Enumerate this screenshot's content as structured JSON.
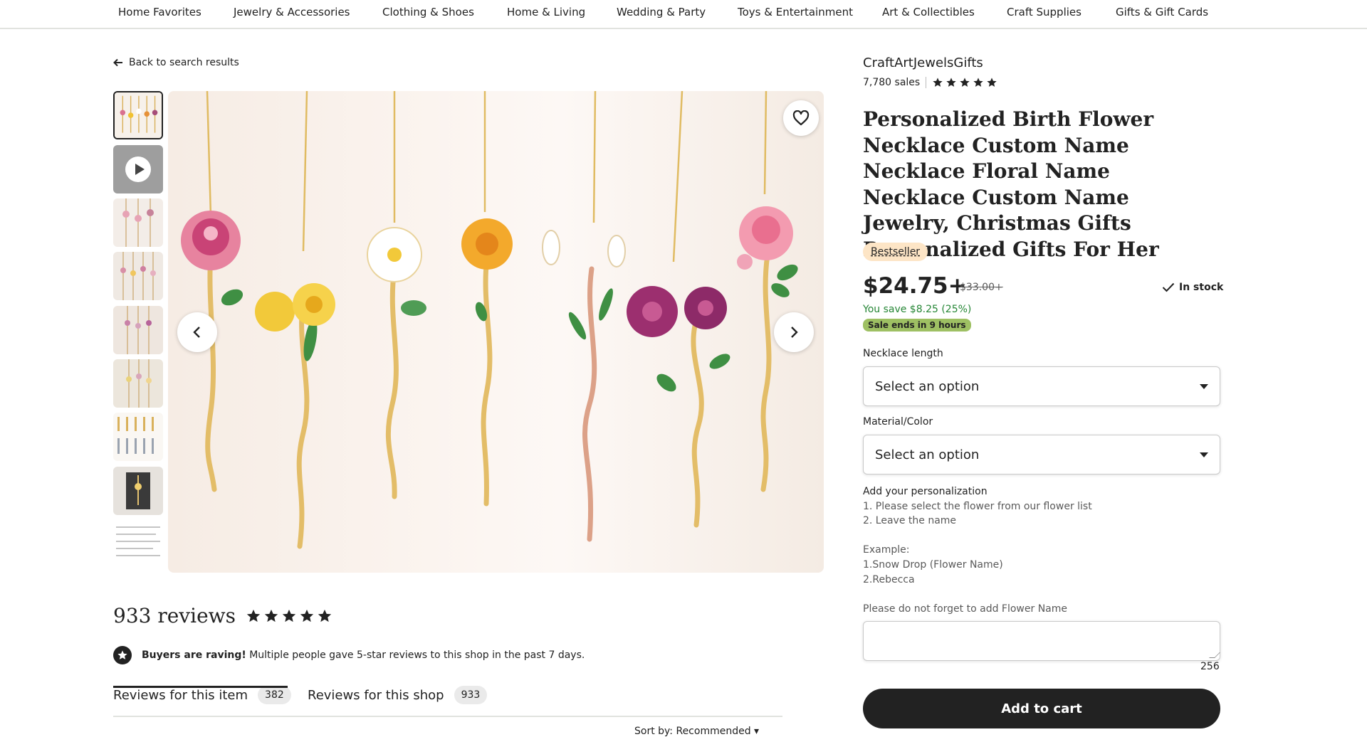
{
  "nav": {
    "items": [
      "Home Favorites",
      "Jewelry & Accessories",
      "Clothing & Shoes",
      "Home & Living",
      "Wedding & Party",
      "Toys & Entertainment",
      "Art & Collectibles",
      "Craft Supplies",
      "Gifts & Gift Cards"
    ]
  },
  "back_link": "Back to search results",
  "shop": {
    "name": "CraftArtJewelsGifts",
    "sales": "7,780 sales",
    "rating_stars": 5
  },
  "product": {
    "title": "Personalized Birth Flower Necklace Custom Name Necklace Floral Name Necklace Custom Name Jewelry, Christmas Gifts Personalized Gifts For Her",
    "badge": "Bestseller",
    "price": "$24.75+",
    "old_price": "$33.00+",
    "stock": "In stock",
    "you_save": "You save $8.25 (25%)",
    "sale_ends": "Sale ends in 9 hours"
  },
  "options": {
    "necklace_length_label": "Necklace length",
    "necklace_length_value": "Select an option",
    "material_label": "Material/Color",
    "material_value": "Select an option"
  },
  "personalization": {
    "heading": "Add your personalization",
    "line1": "1. Please select the flower from our flower list",
    "line2": "2. Leave the name",
    "line3": "Example:",
    "line4": "1.Snow Drop (Flower Name)",
    "line5": "2.Rebecca",
    "line6": "Please do not forget to add Flower Name",
    "char_count": "256"
  },
  "cart": {
    "add_label": "Add to cart"
  },
  "reviews": {
    "count_label": "933 reviews",
    "rating_stars": 5,
    "raving_bold": "Buyers are raving!",
    "raving_text": " Multiple people gave 5-star reviews to this shop in the past 7 days.",
    "tab_item_label": "Reviews for this item",
    "tab_item_count": "382",
    "tab_shop_label": "Reviews for this shop",
    "tab_shop_count": "933",
    "sort_label": "Sort by: Recommended"
  },
  "colors": {
    "text": "#222222",
    "green": "#258635",
    "sale_badge": "#9ec063",
    "bestseller_badge": "#fde5c6"
  }
}
